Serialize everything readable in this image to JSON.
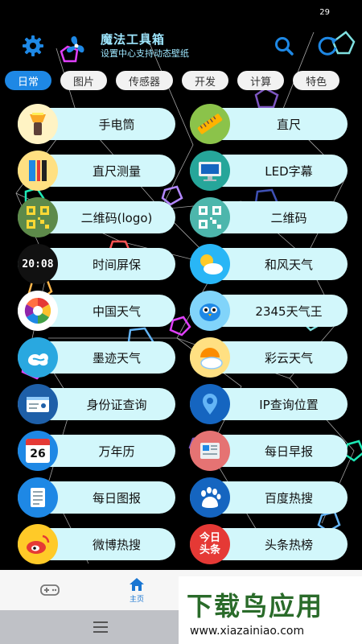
{
  "status": {
    "time": "29"
  },
  "header": {
    "title": "魔法工具箱",
    "subtitle": "设置中心支持动态壁纸",
    "icons": [
      "gear-icon",
      "fan-icon",
      "search-icon",
      "refresh-icon"
    ]
  },
  "tabs": [
    {
      "label": "日常",
      "active": true
    },
    {
      "label": "图片",
      "active": false
    },
    {
      "label": "传感器",
      "active": false
    },
    {
      "label": "开发",
      "active": false
    },
    {
      "label": "计算",
      "active": false
    },
    {
      "label": "特色",
      "active": false
    }
  ],
  "tools": [
    {
      "label": "手电筒",
      "icon": "flashlight-icon"
    },
    {
      "label": "直尺",
      "icon": "ruler-icon"
    },
    {
      "label": "直尺测量",
      "icon": "ruler-measure-icon"
    },
    {
      "label": "LED字幕",
      "icon": "led-monitor-icon"
    },
    {
      "label": "二维码(logo)",
      "icon": "qrcode-logo-icon"
    },
    {
      "label": "二维码",
      "icon": "qrcode-icon"
    },
    {
      "label": "时间屏保",
      "icon": "clock-screensaver-icon",
      "clock_text": "20:08"
    },
    {
      "label": "和风天气",
      "icon": "weather-sun-cloud-icon"
    },
    {
      "label": "中国天气",
      "icon": "china-weather-icon"
    },
    {
      "label": "2345天气王",
      "icon": "weather-bird-icon"
    },
    {
      "label": "墨迹天气",
      "icon": "moji-weather-icon"
    },
    {
      "label": "彩云天气",
      "icon": "caiyun-weather-icon"
    },
    {
      "label": "身份证查询",
      "icon": "id-card-icon"
    },
    {
      "label": "IP查询位置",
      "icon": "location-pin-icon"
    },
    {
      "label": "万年历",
      "icon": "calendar-icon",
      "calendar_day": "26"
    },
    {
      "label": "每日早报",
      "icon": "newspaper-icon"
    },
    {
      "label": "每日图报",
      "icon": "document-icon"
    },
    {
      "label": "百度热搜",
      "icon": "baidu-icon"
    },
    {
      "label": "微博热搜",
      "icon": "weibo-icon"
    },
    {
      "label": "头条热榜",
      "icon": "toutiao-icon",
      "badge_text": "今日头条"
    }
  ],
  "bottom_nav": {
    "items": [
      {
        "label": "",
        "icon": "gamepad-icon"
      },
      {
        "label": "主页",
        "icon": "home-icon"
      }
    ]
  },
  "watermark": {
    "title": "下载鸟应用",
    "url": "www.xiazainiao.com"
  }
}
